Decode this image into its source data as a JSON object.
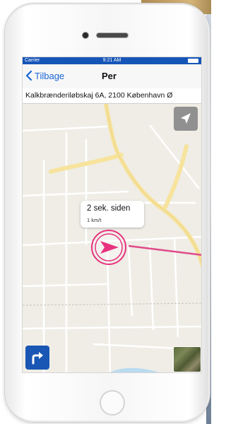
{
  "status_bar": {
    "carrier": "Carrier",
    "time": "9:21 AM"
  },
  "nav": {
    "back_label": "Tilbage",
    "title": "Per"
  },
  "address": "Kalkbrænderiløbskaj 6A, 2100 København Ø",
  "callout": {
    "title": "2 sek. siden",
    "subtitle": "1 km/t"
  },
  "icons": {
    "back": "chevron-left-icon",
    "locate": "location-arrow-icon",
    "directions": "turn-right-icon",
    "marker": "navigation-arrow-icon",
    "satellite": "satellite-map-icon"
  },
  "colors": {
    "accent": "#1a66d6",
    "status_bar": "#1655b8",
    "marker": "#e8327f",
    "pointer_line": "#e04a8a"
  }
}
